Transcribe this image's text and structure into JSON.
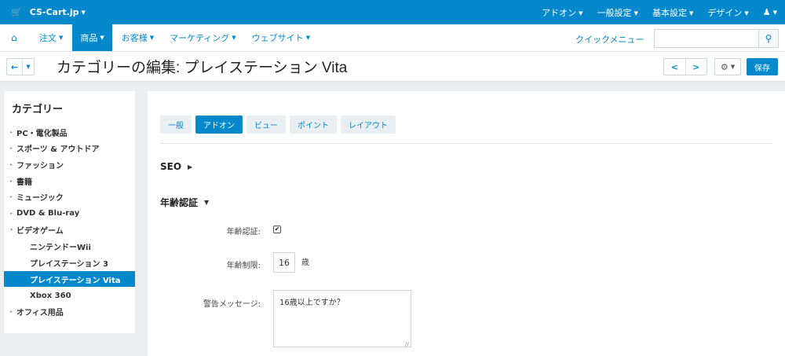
{
  "topbar": {
    "store_name": "CS-Cart.jp",
    "addons": "アドオン",
    "settings": "一般設定",
    "base_settings": "基本設定",
    "design": "デザイン"
  },
  "nav": {
    "orders": "注文",
    "products": "商品",
    "customers": "お客様",
    "marketing": "マーケティング",
    "website": "ウェブサイト",
    "quick_menu": "クイックメニュー",
    "search_value": ""
  },
  "title": {
    "text": "カテゴリーの編集: プレイステーション Vita",
    "save": "保存"
  },
  "sidebar": {
    "heading": "カテゴリー",
    "items": [
      {
        "label": "PC・電化製品",
        "arrow": "▸"
      },
      {
        "label": "スポーツ & アウトドア",
        "arrow": "▸"
      },
      {
        "label": "ファッション",
        "arrow": "▸"
      },
      {
        "label": "書籍",
        "arrow": "▸"
      },
      {
        "label": "ミュージック",
        "arrow": "▸"
      },
      {
        "label": "DVD & Blu-ray",
        "arrow": "▸"
      },
      {
        "label": "ビデオゲーム",
        "arrow": "▾"
      },
      {
        "label": "ニンテンドーWii",
        "arrow": ""
      },
      {
        "label": "プレイステーション 3",
        "arrow": ""
      },
      {
        "label": "プレイステーション Vita",
        "arrow": ""
      },
      {
        "label": "Xbox 360",
        "arrow": ""
      },
      {
        "label": "オフィス用品",
        "arrow": "▸"
      }
    ]
  },
  "tabs": [
    "一般",
    "アドオン",
    "ビュー",
    "ポイント",
    "レイアウト"
  ],
  "sections": {
    "seo": "SEO",
    "age_verification": "年齢認証"
  },
  "form": {
    "age_check_label": "年齢認証:",
    "age_check_checked": true,
    "age_limit_label": "年齢制限:",
    "age_limit_value": "16",
    "age_unit": "歳",
    "warning_label": "警告メッセージ:",
    "warning_value": "16歳以上ですか？"
  },
  "colors": {
    "accent": "#0388cc",
    "background": "#ebeef1"
  }
}
